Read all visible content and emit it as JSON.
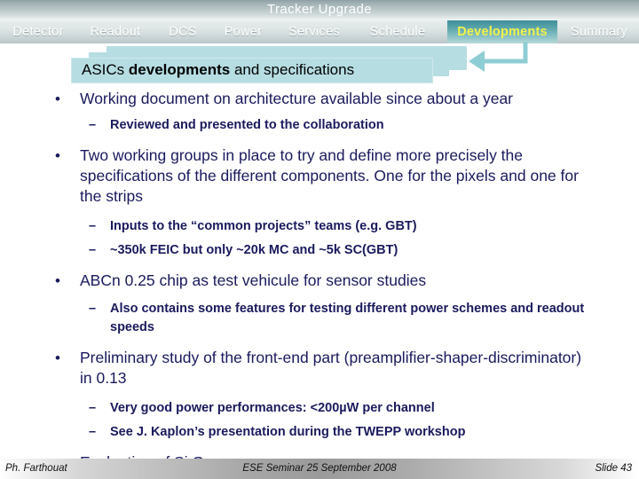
{
  "header": {
    "title": "Tracker Upgrade",
    "tabs": [
      {
        "label": "Detector",
        "active": false
      },
      {
        "label": "Readout",
        "active": false
      },
      {
        "label": "DCS",
        "active": false
      },
      {
        "label": "Power",
        "active": false
      },
      {
        "label": "Services",
        "active": false
      },
      {
        "label": "Schedule",
        "active": false
      },
      {
        "label": "Developments",
        "active": true
      },
      {
        "label": "Summary",
        "active": false
      }
    ],
    "active_tab": "Developments",
    "active_tab_text_color": "#f2f24a",
    "active_tab_bg_color": "#3f8f99"
  },
  "banner": {
    "text_plain": "ASICs developments and specifications",
    "text_pre": "ASICs ",
    "text_bold": "developments",
    "text_post": " and specifications",
    "fill_color": "#b6dde2"
  },
  "arrow": {
    "name": "elbow-arrow-from-developments-tab",
    "color": "#8fcdd4",
    "direction": "left"
  },
  "content": {
    "bullets": [
      {
        "level": 1,
        "marker": "•",
        "text": "Working document on architecture available since about a year"
      },
      {
        "level": 2,
        "marker": "–",
        "text": "Reviewed and presented to the collaboration"
      },
      {
        "level": 1,
        "marker": "•",
        "text": "Two working groups in place to try and define more precisely the specifications of the different components. One for the pixels and one for the strips"
      },
      {
        "level": 2,
        "marker": "–",
        "text": "Inputs to the “common projects” teams (e.g. GBT)"
      },
      {
        "level": 2,
        "marker": "–",
        "text": "~350k FEIC but only ~20k MC and ~5k SC(GBT)"
      },
      {
        "level": 1,
        "marker": "•",
        "text": "ABCn 0.25 chip as test vehicule for sensor studies"
      },
      {
        "level": 2,
        "marker": "–",
        "text": "Also contains some features for testing different power schemes and readout speeds"
      },
      {
        "level": 1,
        "marker": "•",
        "text": "Preliminary study of the front-end part (preamplifier-shaper-discriminator) in 0.13"
      },
      {
        "level": 2,
        "marker": "–",
        "text": "Very good power performances: <200µW per channel"
      },
      {
        "level": 2,
        "marker": "–",
        "text": "See J. Kaplon’s presentation during the TWEPP workshop"
      },
      {
        "level": 1,
        "marker": "•",
        "text": "Evaluation of Si.Ge"
      }
    ],
    "text_color": "#1a1a5e"
  },
  "footer": {
    "author": "Ph. Farthouat",
    "center": "ESE Seminar 25 September 2008",
    "slide": "Slide 43"
  }
}
